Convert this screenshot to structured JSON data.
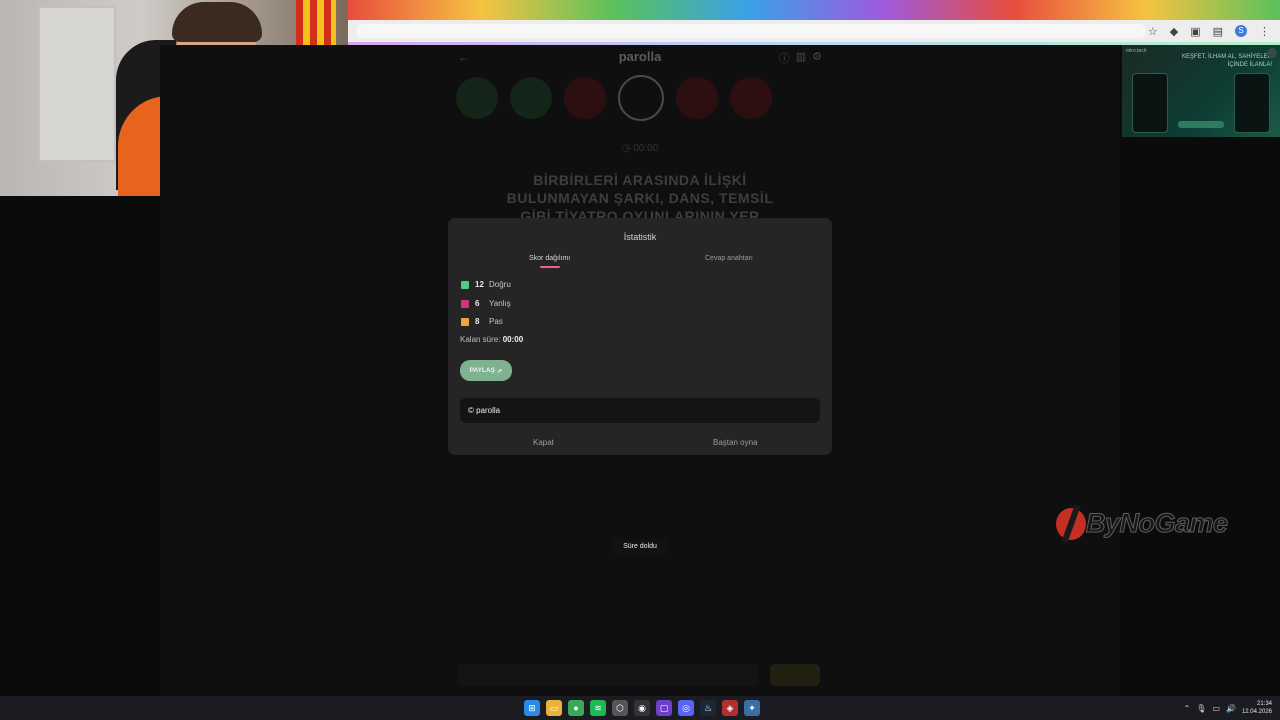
{
  "game": {
    "logo": "parolla",
    "letters": [
      {
        "char": "",
        "state": "green"
      },
      {
        "char": "",
        "state": "green"
      },
      {
        "char": "",
        "state": "red"
      },
      {
        "char": "",
        "state": "active"
      },
      {
        "char": "",
        "state": "red"
      },
      {
        "char": "",
        "state": "red"
      }
    ],
    "timer": "00:00",
    "question": "BİRBİRLERİ ARASINDA İLİŞKİ BULUNMAYAN ŞARKI, DANS, TEMSİL GİBİ TİYATRO OYUNLARININ YER"
  },
  "modal": {
    "title": "İstatistik",
    "tabs": {
      "score": "Skor dağılımı",
      "answers": "Cevap anahtarı"
    },
    "stats": [
      {
        "count": "12",
        "label": "Doğru",
        "color": "#4fcf7a"
      },
      {
        "count": "6",
        "label": "Yanlış",
        "color": "#d2386b"
      },
      {
        "count": "8",
        "label": "Pas",
        "color": "#f3a33c"
      }
    ],
    "remaining_label": "Kalan süre:",
    "remaining_value": "00:00",
    "share_button": "PAYLAŞ",
    "share_text": "© parolla",
    "close_button": "Kapat",
    "restart_button": "Baştan oyna"
  },
  "toast": "Süre doldu",
  "ad": {
    "brand": "miro.tech",
    "title": "KEŞFET, İLHAM AL, SAHİYELER İÇİNDE İLANLA!"
  },
  "watermark": "ByNoGame",
  "taskbar": {
    "time": "21:34",
    "date": "12.04.2026"
  }
}
